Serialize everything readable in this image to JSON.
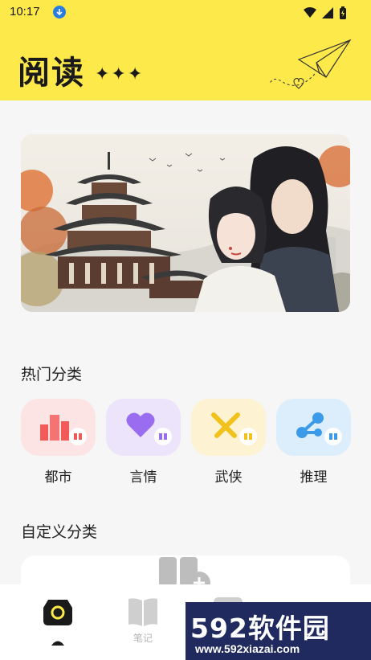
{
  "status_bar": {
    "time": "10:17"
  },
  "header": {
    "title": "阅读",
    "sparkles": "✦✦✦"
  },
  "hot_categories": {
    "title": "热门分类",
    "items": [
      {
        "label": "都市",
        "bg": "#fde4e4",
        "accent": "#f25a5a"
      },
      {
        "label": "言情",
        "bg": "#ece4fb",
        "accent": "#9a6cf0"
      },
      {
        "label": "武侠",
        "bg": "#fdf3d2",
        "accent": "#f1c21b"
      },
      {
        "label": "推理",
        "bg": "#dcedfb",
        "accent": "#3b9be8"
      }
    ]
  },
  "custom_categories": {
    "title": "自定义分类"
  },
  "tabbar": {
    "notes_label": "笔记"
  },
  "watermark": {
    "brand": "592软件园",
    "url": "www.592xiazai.com"
  },
  "colors": {
    "header_bg": "#fee94a",
    "tab_active": "#1a1a1a"
  }
}
